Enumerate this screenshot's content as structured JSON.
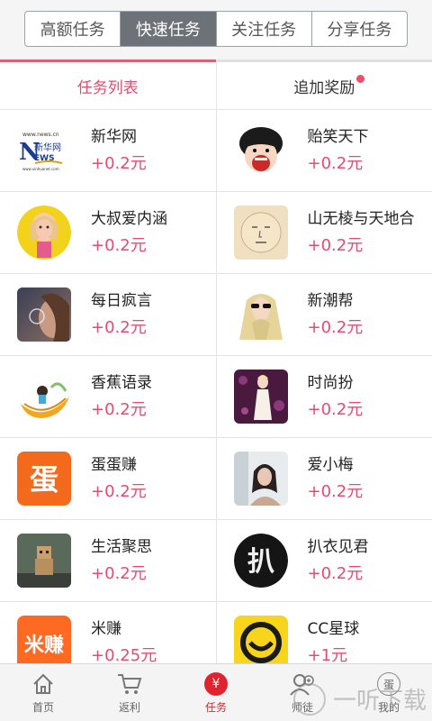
{
  "top_tabs": [
    {
      "label": "高额任务",
      "active": false
    },
    {
      "label": "快速任务",
      "active": true
    },
    {
      "label": "关注任务",
      "active": false
    },
    {
      "label": "分享任务",
      "active": false
    }
  ],
  "sub_tabs": {
    "task_list": "任务列表",
    "bonus": "追加奖励"
  },
  "tasks": [
    {
      "name": "新华网",
      "reward": "+0.2元",
      "icon": "xinhua-news-logo",
      "logo_text_1": "www.news.cn",
      "logo_text_2": "新华网",
      "logo_text_3": "EWS",
      "logo_text_4": "www.xinhuanet.com"
    },
    {
      "name": "贻笑天下",
      "reward": "+0.2元",
      "icon": "cartoon-girl-laughing-icon"
    },
    {
      "name": "大叔爱内涵",
      "reward": "+0.2元",
      "icon": "cartoon-woman-icon"
    },
    {
      "name": "山无棱与天地合",
      "reward": "+0.2元",
      "icon": "drawn-face-icon"
    },
    {
      "name": "每日疯言",
      "reward": "+0.2元",
      "icon": "girl-bubble-photo-icon"
    },
    {
      "name": "新潮帮",
      "reward": "+0.2元",
      "icon": "blonde-sunglasses-icon"
    },
    {
      "name": "香蕉语录",
      "reward": "+0.2元",
      "icon": "banana-girl-icon"
    },
    {
      "name": "时尚扮",
      "reward": "+0.2元",
      "icon": "fashion-illustration-icon"
    },
    {
      "name": "蛋蛋赚",
      "reward": "+0.2元",
      "icon": "dan-logo-icon",
      "logo_text": "蛋"
    },
    {
      "name": "爱小梅",
      "reward": "+0.2元",
      "icon": "portrait-photo-icon"
    },
    {
      "name": "生活聚思",
      "reward": "+0.2元",
      "icon": "cardboard-robot-icon"
    },
    {
      "name": "扒衣见君",
      "reward": "+0.2元",
      "icon": "ba-logo-icon",
      "logo_text": "扒"
    },
    {
      "name": "米赚",
      "reward": "+0.25元",
      "icon": "mizhuan-logo-icon",
      "logo_text": "米赚"
    },
    {
      "name": "CC星球",
      "reward": "+1元",
      "icon": "cc-planet-logo-icon"
    }
  ],
  "bottom_nav": [
    {
      "label": "首页",
      "icon": "home-icon",
      "active": false
    },
    {
      "label": "返利",
      "icon": "cart-icon",
      "active": false
    },
    {
      "label": "任务",
      "icon": "yen-icon",
      "active": true,
      "badge_text": "¥"
    },
    {
      "label": "师徒",
      "icon": "mentor-icon",
      "active": false
    },
    {
      "label": "我的",
      "icon": "egg-icon",
      "active": false,
      "badge_text": "蛋"
    }
  ],
  "watermark": {
    "text": "一听下载"
  },
  "colors": {
    "accent": "#e84a6f",
    "nav_active": "#e0242f",
    "segment_active_bg": "#6d7279"
  }
}
